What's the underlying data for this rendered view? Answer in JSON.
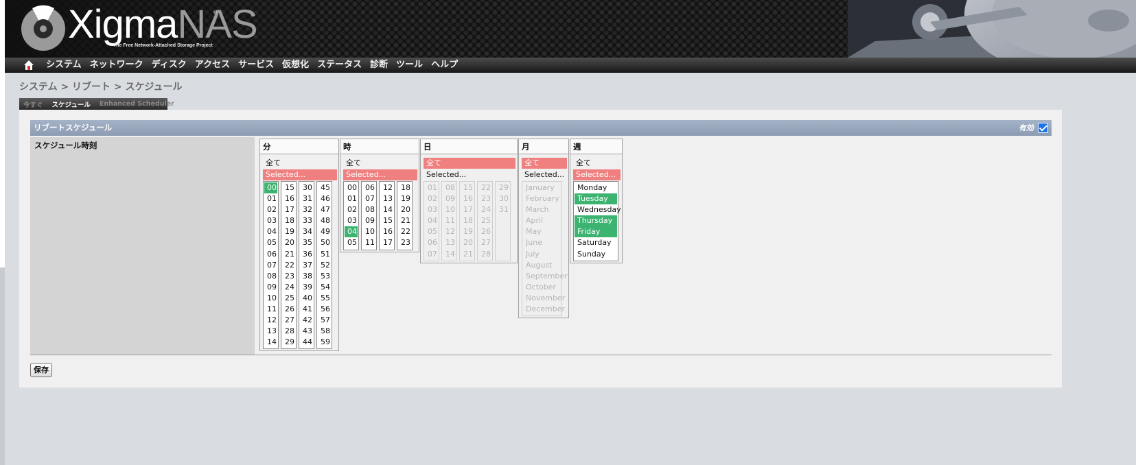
{
  "header": {
    "logo_main": "Xigma",
    "logo_accent": "NAS",
    "logo_reg": "®",
    "tagline": "The Free Network-Attached Storage Project"
  },
  "nav": {
    "home_icon": "home-icon",
    "items": [
      "システム",
      "ネットワーク",
      "ディスク",
      "アクセス",
      "サービス",
      "仮想化",
      "ステータス",
      "診断",
      "ツール",
      "ヘルプ"
    ]
  },
  "breadcrumb": "システム > リブート > スケジュール",
  "tabs": [
    {
      "label": "今すぐ",
      "active": false
    },
    {
      "label": "スケジュール",
      "active": true
    },
    {
      "label": "Enhanced Scheduler",
      "active": false
    }
  ],
  "section": {
    "title": "リブートスケジュール",
    "enabled_label": "有効",
    "enabled": true
  },
  "field_label": "スケジュール時刻",
  "save_label": "保存",
  "pickers": {
    "minutes": {
      "title": "分",
      "all": "全て",
      "selected": "Selected...",
      "mode": "selected",
      "columns": [
        [
          "00",
          "01",
          "02",
          "03",
          "04",
          "05",
          "06",
          "07",
          "08",
          "09",
          "10",
          "11",
          "12",
          "13",
          "14"
        ],
        [
          "15",
          "16",
          "17",
          "18",
          "19",
          "20",
          "21",
          "22",
          "23",
          "24",
          "25",
          "26",
          "27",
          "28",
          "29"
        ],
        [
          "30",
          "31",
          "32",
          "33",
          "34",
          "35",
          "36",
          "37",
          "38",
          "39",
          "40",
          "41",
          "42",
          "43",
          "44"
        ],
        [
          "45",
          "46",
          "47",
          "48",
          "49",
          "50",
          "51",
          "52",
          "53",
          "54",
          "55",
          "56",
          "57",
          "58",
          "59"
        ]
      ],
      "checked": [
        "00"
      ]
    },
    "hours": {
      "title": "時",
      "all": "全て",
      "selected": "Selected...",
      "mode": "selected",
      "columns": [
        [
          "00",
          "01",
          "02",
          "03",
          "04",
          "05"
        ],
        [
          "06",
          "07",
          "08",
          "09",
          "10",
          "11"
        ],
        [
          "12",
          "13",
          "14",
          "15",
          "16",
          "17"
        ],
        [
          "18",
          "19",
          "20",
          "21",
          "22",
          "23"
        ]
      ],
      "checked": [
        "04"
      ]
    },
    "days": {
      "title": "日",
      "all": "全て",
      "selected": "Selected...",
      "mode": "all",
      "columns": [
        [
          "01",
          "02",
          "03",
          "04",
          "05",
          "06",
          "07"
        ],
        [
          "08",
          "09",
          "10",
          "11",
          "12",
          "13",
          "14"
        ],
        [
          "15",
          "16",
          "17",
          "18",
          "19",
          "20",
          "21"
        ],
        [
          "22",
          "23",
          "24",
          "25",
          "26",
          "27",
          "28"
        ],
        [
          "29",
          "30",
          "31"
        ]
      ],
      "checked": []
    },
    "months": {
      "title": "月",
      "all": "全て",
      "selected": "Selected...",
      "mode": "all",
      "columns": [
        [
          "January",
          "February",
          "March",
          "April",
          "May",
          "June",
          "July",
          "August",
          "September",
          "October",
          "November",
          "December"
        ]
      ],
      "checked": []
    },
    "weekdays": {
      "title": "週",
      "all": "全て",
      "selected": "Selected...",
      "mode": "selected",
      "columns": [
        [
          "Monday",
          "Tuesday",
          "Wednesday",
          "Thursday",
          "Friday",
          "Saturday",
          "Sunday"
        ]
      ],
      "checked": [
        "Tuesday",
        "Thursday",
        "Friday"
      ]
    }
  },
  "colors": {
    "selected_mode": "#f08080",
    "checked_item": "#3cb371",
    "section_header": "#98a8bd",
    "checkbox": "#1a73e8"
  }
}
